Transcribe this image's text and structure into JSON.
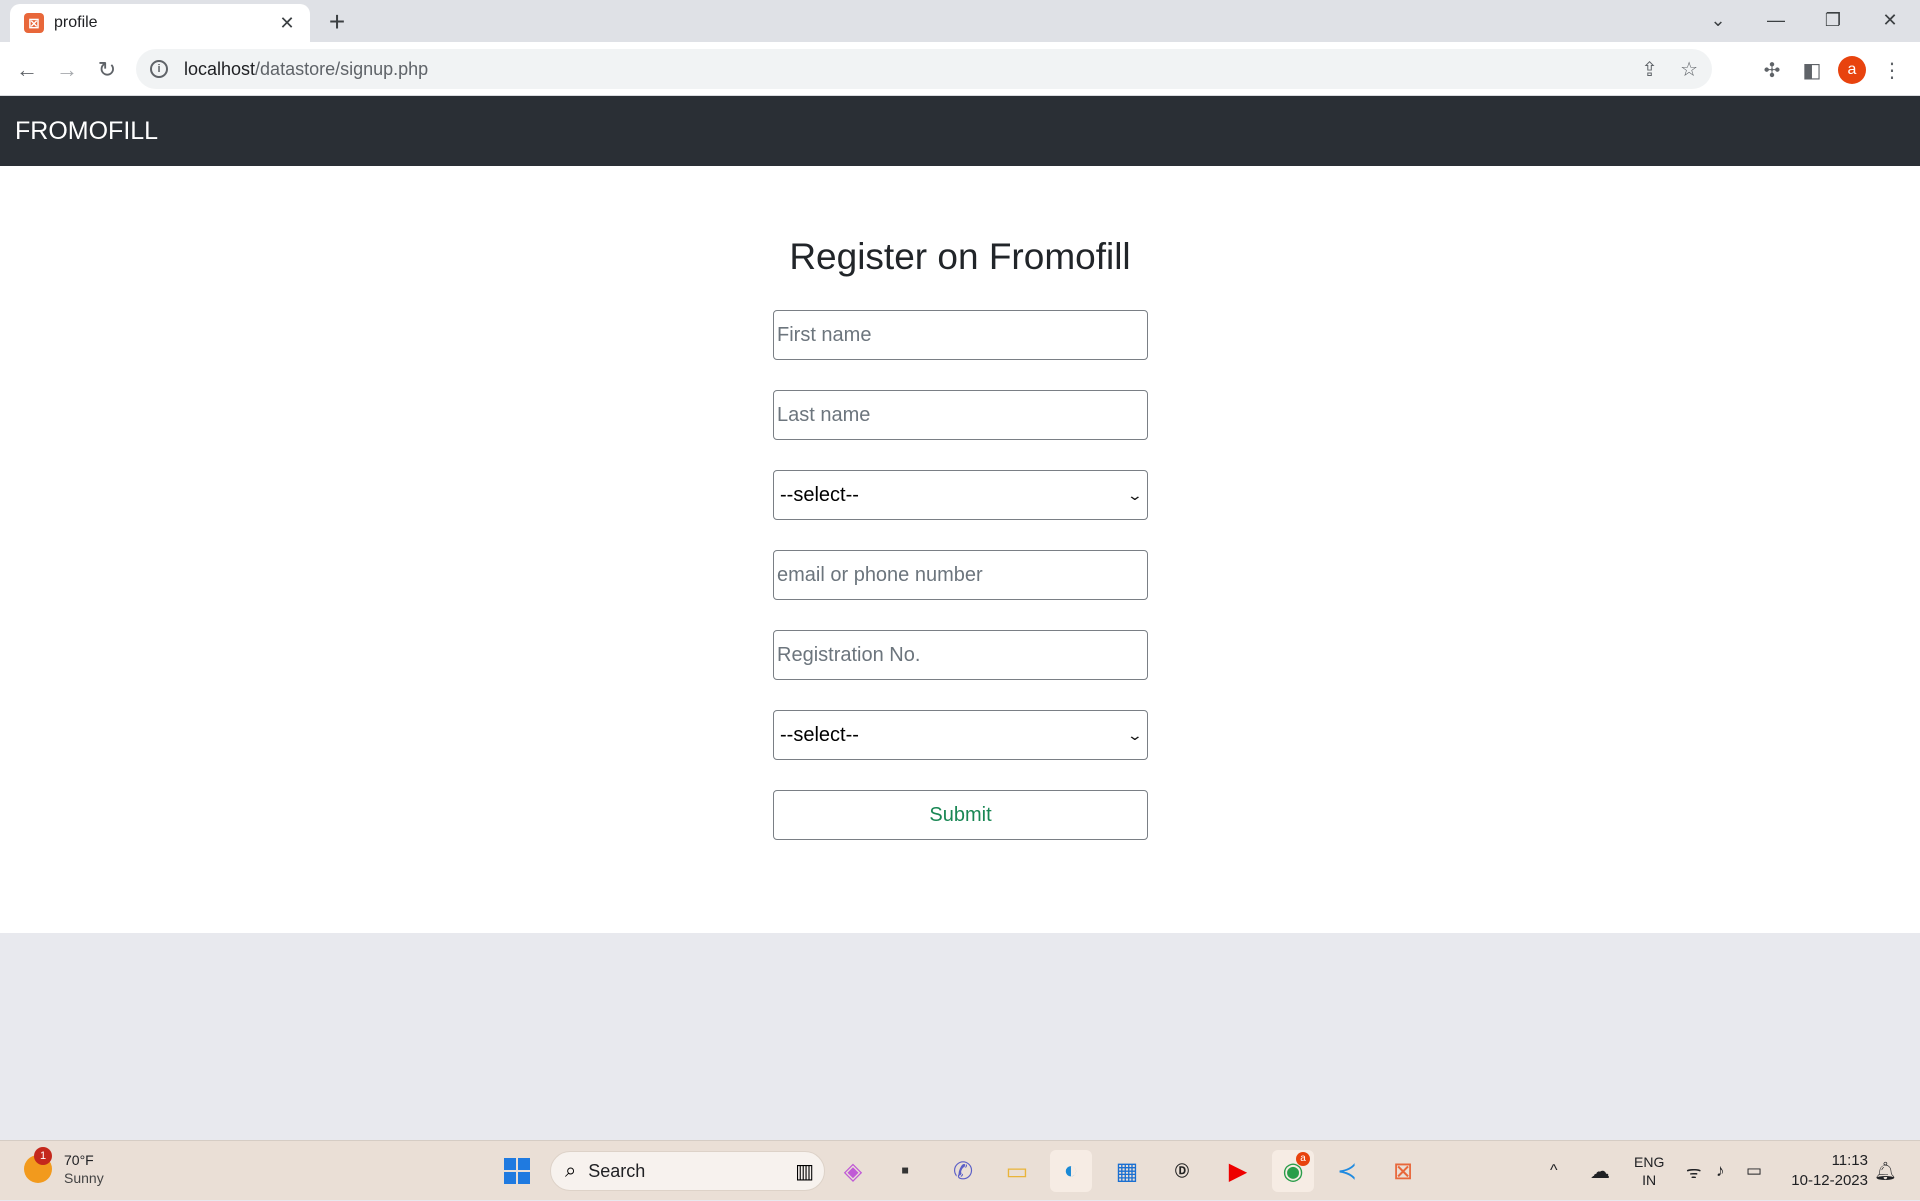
{
  "browser": {
    "tab_title": "profile",
    "tab_close": "✕",
    "new_tab": "+",
    "url_host": "localhost",
    "url_path": "/datastore/signup.php",
    "profile_initial": "a"
  },
  "app": {
    "brand": "FROMOFILL",
    "heading": "Register on Fromofill"
  },
  "form": {
    "first_name_placeholder": "First name",
    "last_name_placeholder": "Last name",
    "select1_value": "--select--",
    "email_placeholder": "email or phone number",
    "registration_placeholder": "Registration No.",
    "select2_value": "--select--",
    "submit_label": "Submit"
  },
  "taskbar": {
    "weather_temp": "70°F",
    "weather_desc": "Sunny",
    "weather_badge": "1",
    "search_label": "Search",
    "lang_top": "ENG",
    "lang_bottom": "IN",
    "time": "11:13",
    "date": "10-12-2023",
    "chrome_badge": "a"
  },
  "colors": {
    "navbar": "#2a2f35",
    "submit_text": "#198754",
    "favicon": "#e8673a"
  }
}
